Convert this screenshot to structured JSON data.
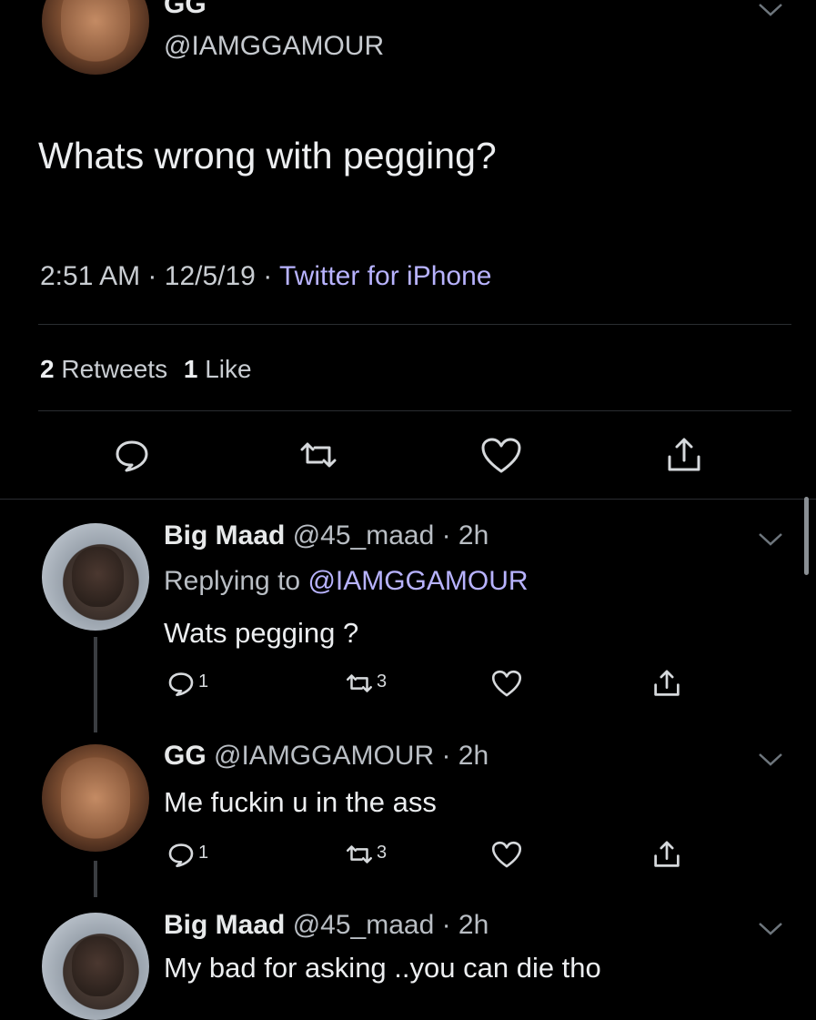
{
  "main_tweet": {
    "display_name": "GG",
    "handle": "@IAMGGAMOUR",
    "text": "Whats wrong with pegging?",
    "time": "2:51 AM",
    "date": "12/5/19",
    "source": "Twitter for iPhone",
    "sep": "·",
    "retweets_count": "2",
    "retweets_label": "Retweets",
    "likes_count": "1",
    "likes_label": "Like"
  },
  "replies": [
    {
      "display_name": "Big Maad",
      "handle": "@45_maad",
      "time": "· 2h",
      "replying_prefix": "Replying to",
      "replying_to": "@IAMGGAMOUR",
      "text": "Wats pegging ?",
      "reply_count": "1",
      "retweet_count": "3"
    },
    {
      "display_name": "GG",
      "handle": "@IAMGGAMOUR",
      "time": "· 2h",
      "text": "Me fuckin u in the ass",
      "reply_count": "1",
      "retweet_count": "3"
    },
    {
      "display_name": "Big Maad",
      "handle": "@45_maad",
      "time": "· 2h",
      "text": "My bad for asking ..you can die tho"
    }
  ],
  "icons": [
    "reply-icon",
    "retweet-icon",
    "like-icon",
    "share-icon",
    "chevron-down-icon"
  ],
  "colors": {
    "background": "#000000",
    "link": "#b8b3ff",
    "text": "#e1e4e8"
  }
}
